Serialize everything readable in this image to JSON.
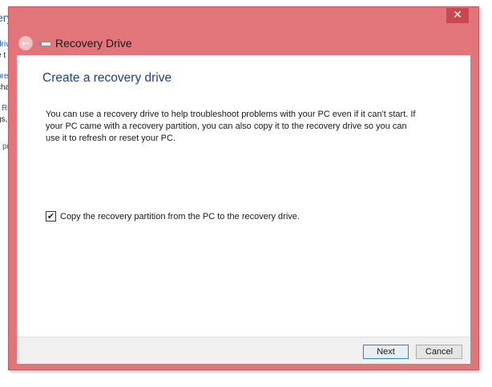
{
  "background_window": {
    "fragments": [
      "ery",
      "driv",
      "e t",
      "ore",
      "cha",
      "Re",
      "gs,",
      "pr"
    ]
  },
  "window": {
    "title": "Recovery Drive",
    "close_glyph": "✕",
    "back_glyph": "←",
    "frame_color": "#e27579"
  },
  "main": {
    "heading": "Create a recovery drive",
    "description": "You can use a recovery drive to help troubleshoot problems with your PC even if it can't start. If your PC came with a recovery partition, you can also copy it to the recovery drive so you can use it to refresh or reset your PC.",
    "checkbox": {
      "checked": true,
      "glyph": "✔",
      "label": "Copy the recovery partition from the PC to the recovery drive."
    }
  },
  "footer": {
    "next_label": "Next",
    "cancel_label": "Cancel"
  }
}
